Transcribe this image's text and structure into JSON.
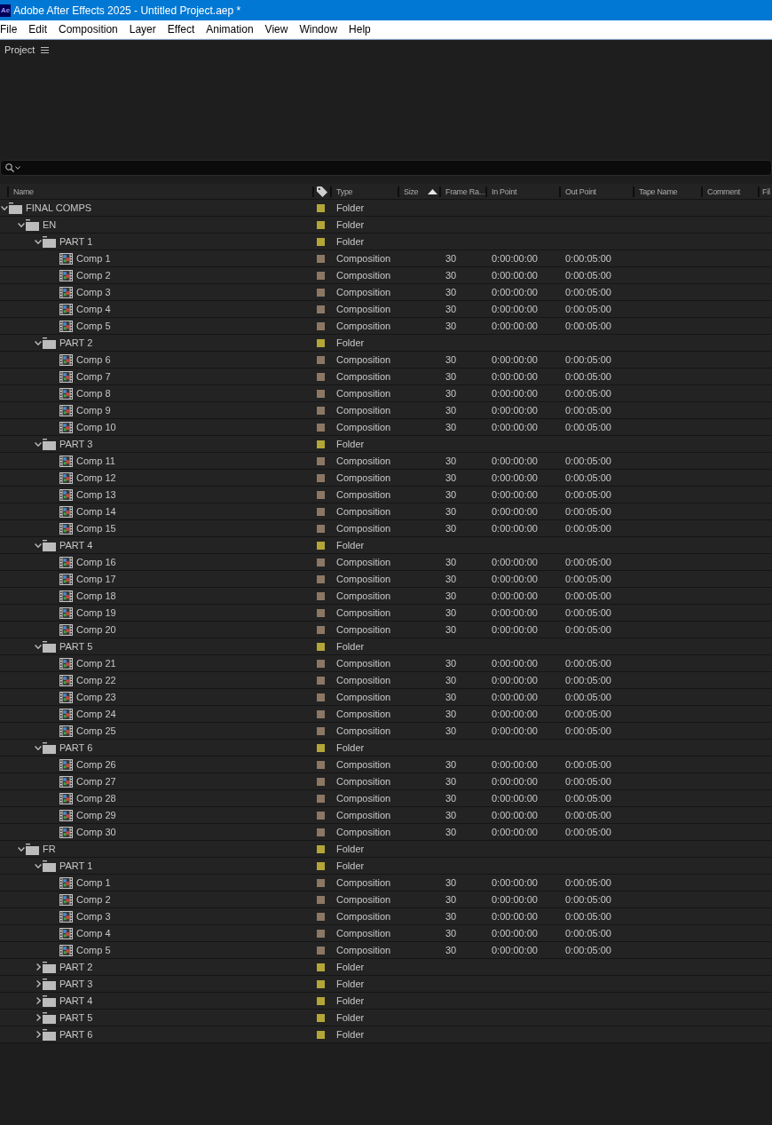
{
  "window": {
    "app_icon": "Ae",
    "title": "Adobe After Effects 2025 - Untitled Project.aep *"
  },
  "menu": [
    "File",
    "Edit",
    "Composition",
    "Layer",
    "Effect",
    "Animation",
    "View",
    "Window",
    "Help"
  ],
  "panel": {
    "title": "Project"
  },
  "table": {
    "columns": [
      {
        "label": "Name",
        "sorted": false
      },
      {
        "label": "Type",
        "sorted": false
      },
      {
        "label": "Size",
        "sorted": true
      },
      {
        "label": "Frame Ra…",
        "sorted": false
      },
      {
        "label": "In Point",
        "sorted": false
      },
      {
        "label": "Out Point",
        "sorted": false
      },
      {
        "label": "Tape Name",
        "sorted": false
      },
      {
        "label": "Comment",
        "sorted": false
      },
      {
        "label": "Fil",
        "sorted": false
      }
    ],
    "rows": [
      {
        "name": "FINAL COMPS",
        "kind": "folder",
        "color": "#b3a637",
        "type": "Folder",
        "expanded": true,
        "children": [
          {
            "name": "EN",
            "kind": "folder",
            "color": "#b3a637",
            "type": "Folder",
            "expanded": true,
            "children": [
              {
                "name": "PART 1",
                "kind": "folder",
                "color": "#b3a637",
                "type": "Folder",
                "expanded": true,
                "children": [
                  {
                    "name": "Comp 1",
                    "kind": "composition",
                    "color": "#8c7764",
                    "type": "Composition",
                    "frame_rate": "30",
                    "in_point": "0:00:00:00",
                    "out_point": "0:00:05:00"
                  },
                  {
                    "name": "Comp 2",
                    "kind": "composition",
                    "color": "#8c7764",
                    "type": "Composition",
                    "frame_rate": "30",
                    "in_point": "0:00:00:00",
                    "out_point": "0:00:05:00"
                  },
                  {
                    "name": "Comp 3",
                    "kind": "composition",
                    "color": "#8c7764",
                    "type": "Composition",
                    "frame_rate": "30",
                    "in_point": "0:00:00:00",
                    "out_point": "0:00:05:00"
                  },
                  {
                    "name": "Comp 4",
                    "kind": "composition",
                    "color": "#8c7764",
                    "type": "Composition",
                    "frame_rate": "30",
                    "in_point": "0:00:00:00",
                    "out_point": "0:00:05:00"
                  },
                  {
                    "name": "Comp 5",
                    "kind": "composition",
                    "color": "#8c7764",
                    "type": "Composition",
                    "frame_rate": "30",
                    "in_point": "0:00:00:00",
                    "out_point": "0:00:05:00"
                  }
                ]
              },
              {
                "name": "PART 2",
                "kind": "folder",
                "color": "#b3a637",
                "type": "Folder",
                "expanded": true,
                "children": [
                  {
                    "name": "Comp 6",
                    "kind": "composition",
                    "color": "#8c7764",
                    "type": "Composition",
                    "frame_rate": "30",
                    "in_point": "0:00:00:00",
                    "out_point": "0:00:05:00"
                  },
                  {
                    "name": "Comp 7",
                    "kind": "composition",
                    "color": "#8c7764",
                    "type": "Composition",
                    "frame_rate": "30",
                    "in_point": "0:00:00:00",
                    "out_point": "0:00:05:00"
                  },
                  {
                    "name": "Comp 8",
                    "kind": "composition",
                    "color": "#8c7764",
                    "type": "Composition",
                    "frame_rate": "30",
                    "in_point": "0:00:00:00",
                    "out_point": "0:00:05:00"
                  },
                  {
                    "name": "Comp 9",
                    "kind": "composition",
                    "color": "#8c7764",
                    "type": "Composition",
                    "frame_rate": "30",
                    "in_point": "0:00:00:00",
                    "out_point": "0:00:05:00"
                  },
                  {
                    "name": "Comp 10",
                    "kind": "composition",
                    "color": "#8c7764",
                    "type": "Composition",
                    "frame_rate": "30",
                    "in_point": "0:00:00:00",
                    "out_point": "0:00:05:00"
                  }
                ]
              },
              {
                "name": "PART 3",
                "kind": "folder",
                "color": "#b3a637",
                "type": "Folder",
                "expanded": true,
                "children": [
                  {
                    "name": "Comp 11",
                    "kind": "composition",
                    "color": "#8c7764",
                    "type": "Composition",
                    "frame_rate": "30",
                    "in_point": "0:00:00:00",
                    "out_point": "0:00:05:00"
                  },
                  {
                    "name": "Comp 12",
                    "kind": "composition",
                    "color": "#8c7764",
                    "type": "Composition",
                    "frame_rate": "30",
                    "in_point": "0:00:00:00",
                    "out_point": "0:00:05:00"
                  },
                  {
                    "name": "Comp 13",
                    "kind": "composition",
                    "color": "#8c7764",
                    "type": "Composition",
                    "frame_rate": "30",
                    "in_point": "0:00:00:00",
                    "out_point": "0:00:05:00"
                  },
                  {
                    "name": "Comp 14",
                    "kind": "composition",
                    "color": "#8c7764",
                    "type": "Composition",
                    "frame_rate": "30",
                    "in_point": "0:00:00:00",
                    "out_point": "0:00:05:00"
                  },
                  {
                    "name": "Comp 15",
                    "kind": "composition",
                    "color": "#8c7764",
                    "type": "Composition",
                    "frame_rate": "30",
                    "in_point": "0:00:00:00",
                    "out_point": "0:00:05:00"
                  }
                ]
              },
              {
                "name": "PART 4",
                "kind": "folder",
                "color": "#b3a637",
                "type": "Folder",
                "expanded": true,
                "children": [
                  {
                    "name": "Comp 16",
                    "kind": "composition",
                    "color": "#8c7764",
                    "type": "Composition",
                    "frame_rate": "30",
                    "in_point": "0:00:00:00",
                    "out_point": "0:00:05:00"
                  },
                  {
                    "name": "Comp 17",
                    "kind": "composition",
                    "color": "#8c7764",
                    "type": "Composition",
                    "frame_rate": "30",
                    "in_point": "0:00:00:00",
                    "out_point": "0:00:05:00"
                  },
                  {
                    "name": "Comp 18",
                    "kind": "composition",
                    "color": "#8c7764",
                    "type": "Composition",
                    "frame_rate": "30",
                    "in_point": "0:00:00:00",
                    "out_point": "0:00:05:00"
                  },
                  {
                    "name": "Comp 19",
                    "kind": "composition",
                    "color": "#8c7764",
                    "type": "Composition",
                    "frame_rate": "30",
                    "in_point": "0:00:00:00",
                    "out_point": "0:00:05:00"
                  },
                  {
                    "name": "Comp 20",
                    "kind": "composition",
                    "color": "#8c7764",
                    "type": "Composition",
                    "frame_rate": "30",
                    "in_point": "0:00:00:00",
                    "out_point": "0:00:05:00"
                  }
                ]
              },
              {
                "name": "PART 5",
                "kind": "folder",
                "color": "#b3a637",
                "type": "Folder",
                "expanded": true,
                "children": [
                  {
                    "name": "Comp 21",
                    "kind": "composition",
                    "color": "#8c7764",
                    "type": "Composition",
                    "frame_rate": "30",
                    "in_point": "0:00:00:00",
                    "out_point": "0:00:05:00"
                  },
                  {
                    "name": "Comp 22",
                    "kind": "composition",
                    "color": "#8c7764",
                    "type": "Composition",
                    "frame_rate": "30",
                    "in_point": "0:00:00:00",
                    "out_point": "0:00:05:00"
                  },
                  {
                    "name": "Comp 23",
                    "kind": "composition",
                    "color": "#8c7764",
                    "type": "Composition",
                    "frame_rate": "30",
                    "in_point": "0:00:00:00",
                    "out_point": "0:00:05:00"
                  },
                  {
                    "name": "Comp 24",
                    "kind": "composition",
                    "color": "#8c7764",
                    "type": "Composition",
                    "frame_rate": "30",
                    "in_point": "0:00:00:00",
                    "out_point": "0:00:05:00"
                  },
                  {
                    "name": "Comp 25",
                    "kind": "composition",
                    "color": "#8c7764",
                    "type": "Composition",
                    "frame_rate": "30",
                    "in_point": "0:00:00:00",
                    "out_point": "0:00:05:00"
                  }
                ]
              },
              {
                "name": "PART 6",
                "kind": "folder",
                "color": "#b3a637",
                "type": "Folder",
                "expanded": true,
                "children": [
                  {
                    "name": "Comp 26",
                    "kind": "composition",
                    "color": "#8c7764",
                    "type": "Composition",
                    "frame_rate": "30",
                    "in_point": "0:00:00:00",
                    "out_point": "0:00:05:00"
                  },
                  {
                    "name": "Comp 27",
                    "kind": "composition",
                    "color": "#8c7764",
                    "type": "Composition",
                    "frame_rate": "30",
                    "in_point": "0:00:00:00",
                    "out_point": "0:00:05:00"
                  },
                  {
                    "name": "Comp 28",
                    "kind": "composition",
                    "color": "#8c7764",
                    "type": "Composition",
                    "frame_rate": "30",
                    "in_point": "0:00:00:00",
                    "out_point": "0:00:05:00"
                  },
                  {
                    "name": "Comp 29",
                    "kind": "composition",
                    "color": "#8c7764",
                    "type": "Composition",
                    "frame_rate": "30",
                    "in_point": "0:00:00:00",
                    "out_point": "0:00:05:00"
                  },
                  {
                    "name": "Comp 30",
                    "kind": "composition",
                    "color": "#8c7764",
                    "type": "Composition",
                    "frame_rate": "30",
                    "in_point": "0:00:00:00",
                    "out_point": "0:00:05:00"
                  }
                ]
              }
            ]
          },
          {
            "name": "FR",
            "kind": "folder",
            "color": "#b3a637",
            "type": "Folder",
            "expanded": true,
            "children": [
              {
                "name": "PART 1",
                "kind": "folder",
                "color": "#b3a637",
                "type": "Folder",
                "expanded": true,
                "children": [
                  {
                    "name": "Comp 1",
                    "kind": "composition",
                    "color": "#8c7764",
                    "type": "Composition",
                    "frame_rate": "30",
                    "in_point": "0:00:00:00",
                    "out_point": "0:00:05:00"
                  },
                  {
                    "name": "Comp 2",
                    "kind": "composition",
                    "color": "#8c7764",
                    "type": "Composition",
                    "frame_rate": "30",
                    "in_point": "0:00:00:00",
                    "out_point": "0:00:05:00"
                  },
                  {
                    "name": "Comp 3",
                    "kind": "composition",
                    "color": "#8c7764",
                    "type": "Composition",
                    "frame_rate": "30",
                    "in_point": "0:00:00:00",
                    "out_point": "0:00:05:00"
                  },
                  {
                    "name": "Comp 4",
                    "kind": "composition",
                    "color": "#8c7764",
                    "type": "Composition",
                    "frame_rate": "30",
                    "in_point": "0:00:00:00",
                    "out_point": "0:00:05:00"
                  },
                  {
                    "name": "Comp 5",
                    "kind": "composition",
                    "color": "#8c7764",
                    "type": "Composition",
                    "frame_rate": "30",
                    "in_point": "0:00:00:00",
                    "out_point": "0:00:05:00"
                  }
                ]
              },
              {
                "name": "PART 2",
                "kind": "folder",
                "color": "#b3a637",
                "type": "Folder",
                "expanded": false
              },
              {
                "name": "PART 3",
                "kind": "folder",
                "color": "#b3a637",
                "type": "Folder",
                "expanded": false
              },
              {
                "name": "PART 4",
                "kind": "folder",
                "color": "#b3a637",
                "type": "Folder",
                "expanded": false
              },
              {
                "name": "PART 5",
                "kind": "folder",
                "color": "#b3a637",
                "type": "Folder",
                "expanded": false
              },
              {
                "name": "PART 6",
                "kind": "folder",
                "color": "#b3a637",
                "type": "Folder",
                "expanded": false
              }
            ]
          }
        ]
      }
    ]
  }
}
